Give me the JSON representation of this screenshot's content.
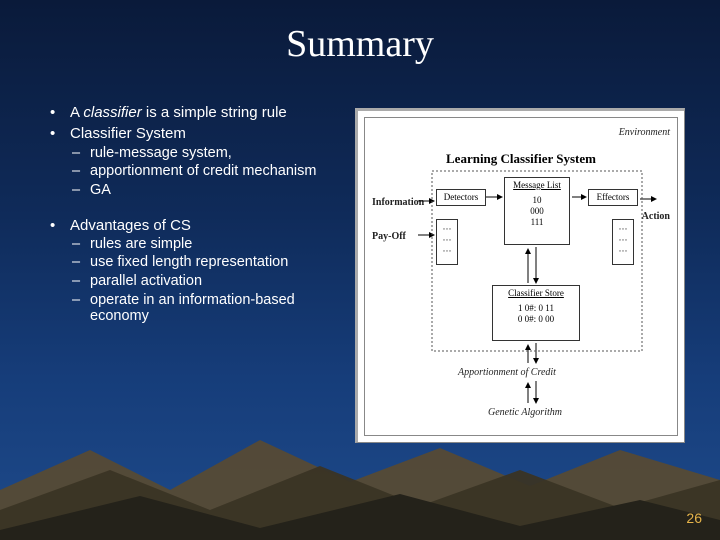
{
  "title": "Summary",
  "bullets": {
    "l1_1_pre": "A ",
    "l1_1_term": "classifier",
    "l1_1_post": " is a simple string rule",
    "l1_2": "Classifier System",
    "l2_1": "rule-message system,",
    "l2_2": "apportionment of credit mechanism",
    "l2_3": "GA",
    "l1_3": "Advantages of CS",
    "l2_4": "rules are simple",
    "l2_5": " use fixed length representation",
    "l2_6": " parallel activation",
    "l2_7": " operate in an information-based economy"
  },
  "diagram": {
    "env": "Environment",
    "title": "Learning Classifier System",
    "info": "Information",
    "payoff": "Pay-Off",
    "action": "Action",
    "detectors": "Detectors",
    "effectors": "Effectors",
    "msg_list": "Message List",
    "msg_1": "10",
    "msg_2": "000",
    "msg_3": "111",
    "cls_store": "Classifier Store",
    "cls_1": "1 0#: 0 11",
    "cls_2": "0 0#: 0 00",
    "list1_a": "···",
    "list1_b": "···",
    "list1_c": "···",
    "list2_a": "···",
    "list2_b": "···",
    "list2_c": "···",
    "apportion": "Apportionment of Credit",
    "ga": "Genetic Algorithm"
  },
  "page_number": "26"
}
